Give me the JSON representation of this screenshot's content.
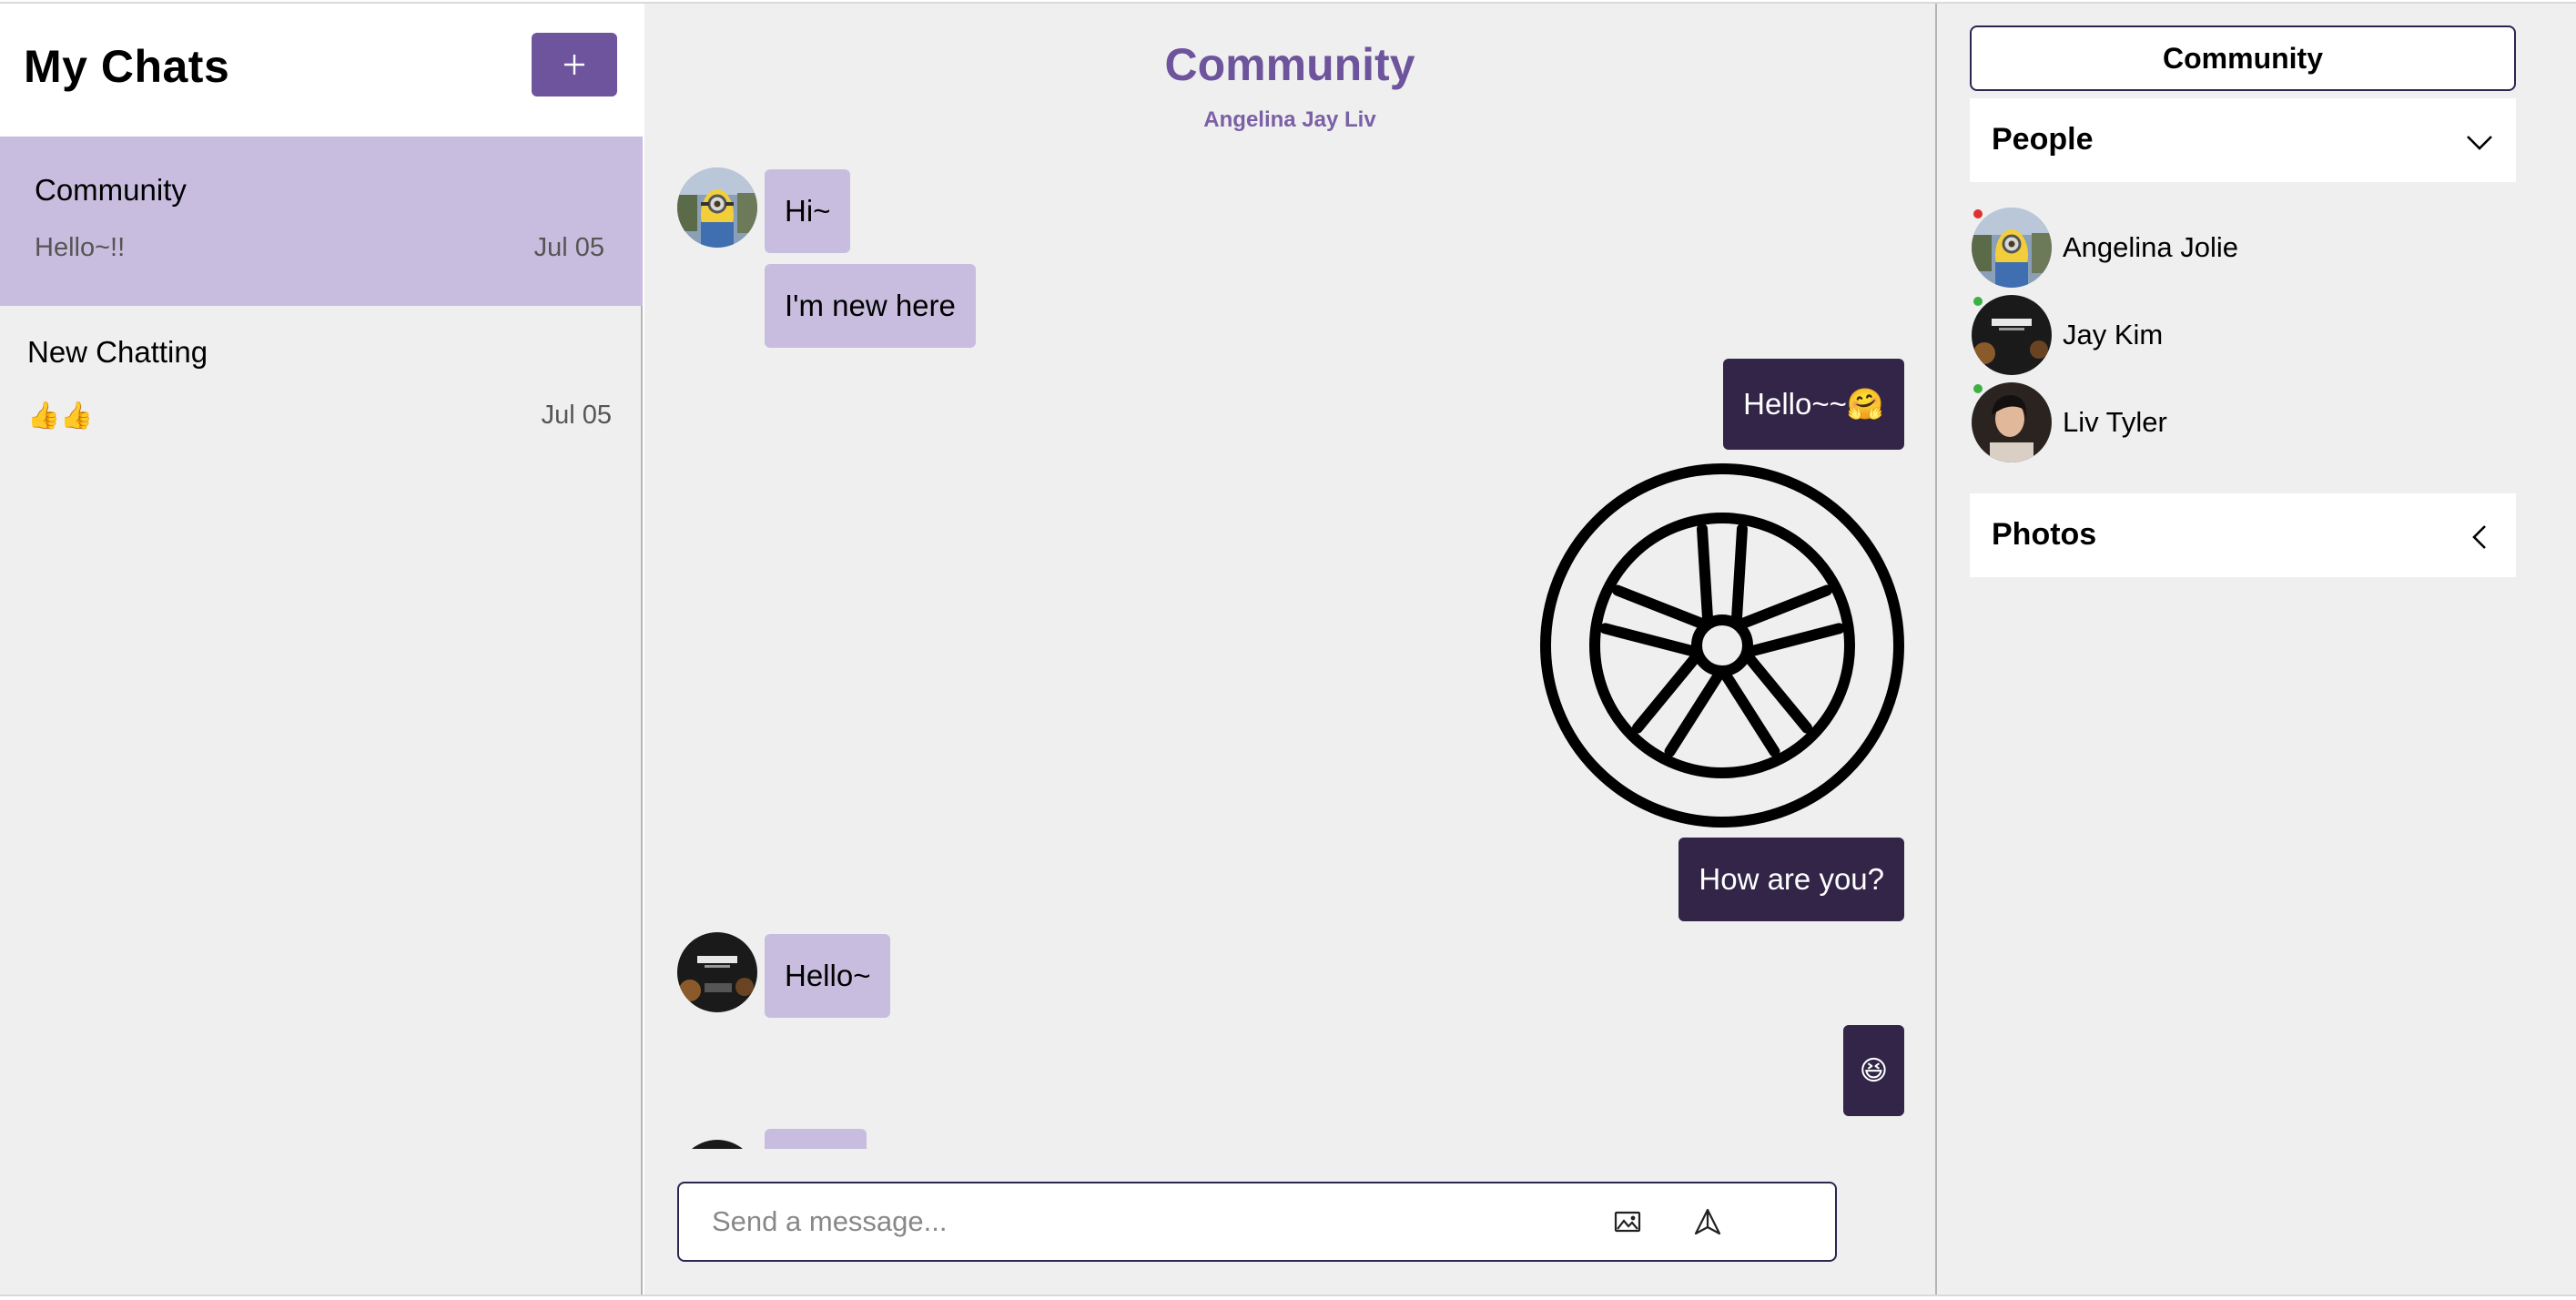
{
  "sidebar": {
    "title": "My Chats",
    "new_button_icon": "plus-icon",
    "chats": [
      {
        "title": "Community",
        "preview": "Hello~!!",
        "date": "Jul 05",
        "active": true
      },
      {
        "title": "New Chatting",
        "preview": "👍👍",
        "date": "Jul 05",
        "active": false
      }
    ]
  },
  "chat": {
    "title": "Community",
    "members": "Angelina Jay Liv",
    "messages": [
      {
        "direction": "incoming",
        "sender": "Angelina Jolie",
        "text": "Hi~"
      },
      {
        "direction": "incoming",
        "sender": "Angelina Jolie",
        "text": "I'm new here"
      },
      {
        "direction": "outgoing",
        "text": "Hello~~🤗"
      },
      {
        "direction": "outgoing",
        "type": "image",
        "image": "wheel-icon"
      },
      {
        "direction": "outgoing",
        "text": "How are you?"
      },
      {
        "direction": "incoming",
        "sender": "Jay Kim",
        "text": "Hello~"
      },
      {
        "direction": "outgoing",
        "text": "😆"
      }
    ],
    "composer": {
      "placeholder": "Send a message...",
      "value": "",
      "icons": [
        "image-icon",
        "send-icon"
      ]
    }
  },
  "panel": {
    "room_button": "Community",
    "people_label": "People",
    "people_expanded": true,
    "people": [
      {
        "name": "Angelina Jolie",
        "status_color": "#e03030"
      },
      {
        "name": "Jay Kim",
        "status_color": "#3cb043"
      },
      {
        "name": "Liv Tyler",
        "status_color": "#3cb043"
      }
    ],
    "photos_label": "Photos",
    "photos_expanded": false
  },
  "colors": {
    "accent": "#6e549c",
    "incoming_bubble": "#c8bdde",
    "outgoing_bubble": "#322548",
    "background": "#efefef"
  }
}
